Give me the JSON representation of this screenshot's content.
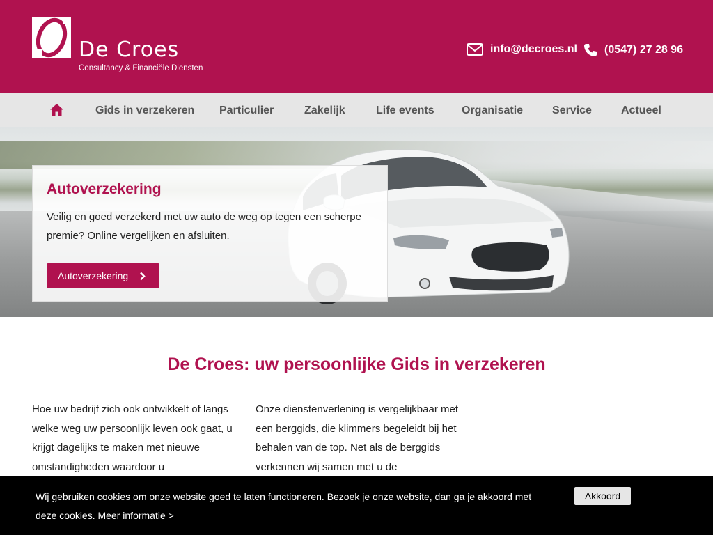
{
  "header": {
    "logo_name": "De Croes",
    "logo_subtitle": "Consultancy & Financiële Diensten",
    "email": "info@decroes.nl",
    "phone": "(0547) 27 28 96"
  },
  "nav": {
    "home_icon": "home-icon",
    "items": [
      "Gids in verzekeren",
      "Particulier",
      "Zakelijk",
      "Life events",
      "Organisatie",
      "Service",
      "Actueel"
    ]
  },
  "hero": {
    "title": "Autoverzekering",
    "text": "Veilig en goed verzekerd met uw auto de weg op tegen een scherpe premie? Online vergelijken en afsluiten.",
    "button_label": "Autoverzekering"
  },
  "main": {
    "title": "De Croes: uw persoonlijke Gids in verzekeren",
    "col1": "Hoe uw bedrijf zich ook ontwikkelt of langs welke weg uw persoonlijk leven ook gaat, u krijgt dagelijks te maken met nieuwe omstandigheden waardoor u",
    "col2": "Onze dienstenverlening is vergelijkbaar met een berggids, die klimmers begeleidt bij het behalen van de top. Net als de berggids verkennen wij samen met u de"
  },
  "cookie": {
    "text": "Wij gebruiken cookies om onze website goed te laten functioneren. Bezoek je onze website, dan ga je akkoord met deze cookies.",
    "link": "Meer informatie >",
    "accept": "Akkoord"
  },
  "colors": {
    "brand": "#b0124f",
    "nav_bg": "#e6e6e6",
    "cookie_bg": "#000000"
  }
}
